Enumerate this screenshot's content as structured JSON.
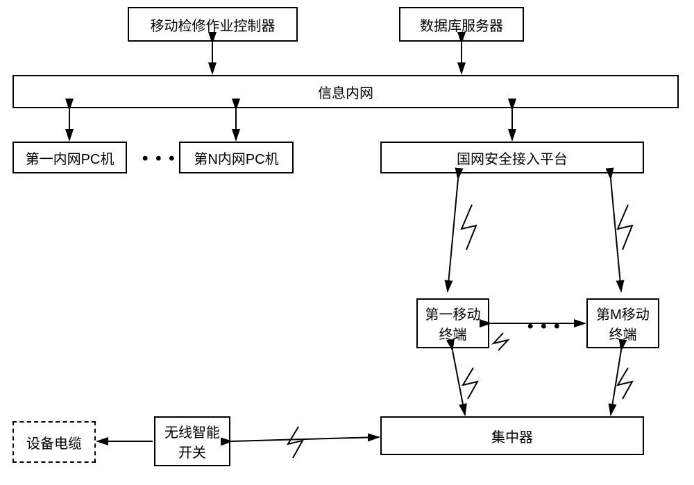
{
  "nodes": {
    "mobile_controller": "移动检修作业控制器",
    "db_server": "数据库服务器",
    "info_intranet": "信息内网",
    "pc1": "第一内网PC机",
    "pcN": "第N内网PC机",
    "security_platform": "国网安全接入平台",
    "mobile_terminal_1": "第一移动终端",
    "mobile_terminal_m": "第M移动终端",
    "concentrator": "集中器",
    "wireless_switch": "无线智能开关",
    "equipment_cable": "设备电缆"
  },
  "ellipsis": "• • •"
}
